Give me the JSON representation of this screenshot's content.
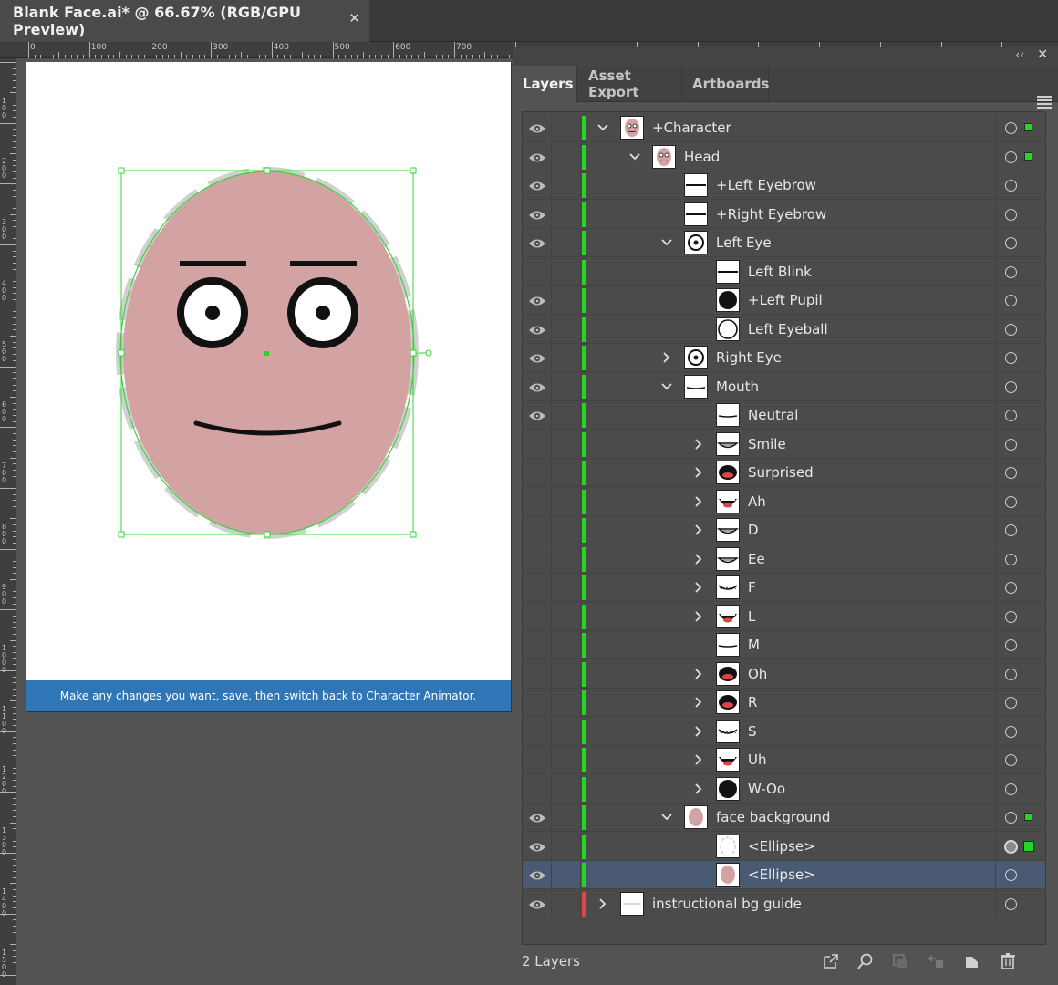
{
  "document": {
    "tab_title": "Blank Face.ai* @ 66.67% (RGB/GPU Preview)",
    "close_glyph": "✕"
  },
  "ruler": {
    "h_labels": [
      "0",
      "100",
      "200",
      "300",
      "400",
      "500",
      "600",
      "700"
    ],
    "v_labels": [
      "100",
      "200",
      "300",
      "400",
      "500",
      "600",
      "700",
      "800",
      "900",
      "1000",
      "1100",
      "1200",
      "1300",
      "1400",
      "1500"
    ]
  },
  "artboard": {
    "banner_text": "Make any changes you want, save, then switch back to Character Animator."
  },
  "panel": {
    "collapse_glyph": "‹‹",
    "close_glyph": "✕",
    "tabs": [
      {
        "label": "Layers",
        "active": true
      },
      {
        "label": "Asset Export",
        "active": false
      },
      {
        "label": "Artboards",
        "active": false
      }
    ],
    "footer": {
      "count_label": "2 Layers",
      "icons": [
        "export-icon",
        "search-icon",
        "clipping-mask-icon",
        "move-selection-icon",
        "new-sublayer-icon",
        "new-layer-icon",
        "delete-icon"
      ]
    }
  },
  "colors": {
    "layer_green": "#22d622",
    "layer_red": "#e04848",
    "selection_blue": "#4a5a73",
    "face_fill": "#d3a3a3",
    "banner_blue": "#2e76b6"
  },
  "layers": [
    {
      "label": "+Character",
      "indent": 0,
      "visible": true,
      "twisty": "open",
      "thumb": "face",
      "color": "green",
      "target": "ring",
      "selected_square": true
    },
    {
      "label": "Head",
      "indent": 1,
      "visible": true,
      "twisty": "open",
      "thumb": "face",
      "color": "green",
      "target": "ring",
      "selected_square": true
    },
    {
      "label": "+Left Eyebrow",
      "indent": 2,
      "visible": true,
      "twisty": "none",
      "thumb": "line",
      "color": "green",
      "target": "ring"
    },
    {
      "label": "+Right Eyebrow",
      "indent": 2,
      "visible": true,
      "twisty": "none",
      "thumb": "line",
      "color": "green",
      "target": "ring"
    },
    {
      "label": "Left Eye",
      "indent": 2,
      "visible": true,
      "twisty": "open",
      "thumb": "eye",
      "color": "green",
      "target": "ring"
    },
    {
      "label": "Left Blink",
      "indent": 3,
      "visible": false,
      "twisty": "none",
      "thumb": "line",
      "color": "green",
      "target": "ring"
    },
    {
      "label": "+Left Pupil",
      "indent": 3,
      "visible": true,
      "twisty": "none",
      "thumb": "dot",
      "color": "green",
      "target": "ring"
    },
    {
      "label": "Left Eyeball",
      "indent": 3,
      "visible": true,
      "twisty": "none",
      "thumb": "ring",
      "color": "green",
      "target": "ring"
    },
    {
      "label": "Right Eye",
      "indent": 2,
      "visible": true,
      "twisty": "closed",
      "thumb": "eye",
      "color": "green",
      "target": "ring"
    },
    {
      "label": "Mouth",
      "indent": 2,
      "visible": true,
      "twisty": "open",
      "thumb": "mouth-line",
      "color": "green",
      "target": "ring"
    },
    {
      "label": "Neutral",
      "indent": 3,
      "visible": true,
      "twisty": "none",
      "thumb": "mouth-line",
      "color": "green",
      "target": "ring"
    },
    {
      "label": "Smile",
      "indent": 3,
      "visible": false,
      "twisty": "closed",
      "thumb": "mouth-smile",
      "color": "green",
      "target": "ring"
    },
    {
      "label": "Surprised",
      "indent": 3,
      "visible": false,
      "twisty": "closed",
      "thumb": "mouth-open-red",
      "color": "green",
      "target": "ring"
    },
    {
      "label": "Ah",
      "indent": 3,
      "visible": false,
      "twisty": "closed",
      "thumb": "mouth-ah",
      "color": "green",
      "target": "ring"
    },
    {
      "label": "D",
      "indent": 3,
      "visible": false,
      "twisty": "closed",
      "thumb": "mouth-smile",
      "color": "green",
      "target": "ring"
    },
    {
      "label": "Ee",
      "indent": 3,
      "visible": false,
      "twisty": "closed",
      "thumb": "mouth-smile",
      "color": "green",
      "target": "ring"
    },
    {
      "label": "F",
      "indent": 3,
      "visible": false,
      "twisty": "closed",
      "thumb": "mouth-teeth",
      "color": "green",
      "target": "ring"
    },
    {
      "label": "L",
      "indent": 3,
      "visible": false,
      "twisty": "closed",
      "thumb": "mouth-ah",
      "color": "green",
      "target": "ring"
    },
    {
      "label": "M",
      "indent": 3,
      "visible": false,
      "twisty": "none",
      "thumb": "mouth-line",
      "color": "green",
      "target": "ring"
    },
    {
      "label": "Oh",
      "indent": 3,
      "visible": false,
      "twisty": "closed",
      "thumb": "mouth-open-red",
      "color": "green",
      "target": "ring"
    },
    {
      "label": "R",
      "indent": 3,
      "visible": false,
      "twisty": "closed",
      "thumb": "mouth-open-red",
      "color": "green",
      "target": "ring"
    },
    {
      "label": "S",
      "indent": 3,
      "visible": false,
      "twisty": "closed",
      "thumb": "mouth-teeth",
      "color": "green",
      "target": "ring"
    },
    {
      "label": "Uh",
      "indent": 3,
      "visible": false,
      "twisty": "closed",
      "thumb": "mouth-ah",
      "color": "green",
      "target": "ring"
    },
    {
      "label": "W-Oo",
      "indent": 3,
      "visible": false,
      "twisty": "closed",
      "thumb": "dot",
      "color": "green",
      "target": "ring"
    },
    {
      "label": "face background",
      "indent": 2,
      "visible": true,
      "twisty": "open",
      "thumb": "oval",
      "color": "green",
      "target": "ring",
      "selected_square": true
    },
    {
      "label": "<Ellipse>",
      "indent": 3,
      "visible": true,
      "twisty": "none",
      "thumb": "dashed-oval",
      "color": "green",
      "target": "filled",
      "selected_square": true,
      "big_square": true
    },
    {
      "label": "<Ellipse>",
      "indent": 3,
      "visible": true,
      "twisty": "none",
      "thumb": "oval",
      "color": "green",
      "target": "ring",
      "selected": true
    },
    {
      "label": "instructional bg guide",
      "indent": 0,
      "visible": true,
      "twisty": "closed",
      "thumb": "guide",
      "color": "red",
      "target": "ring"
    }
  ]
}
